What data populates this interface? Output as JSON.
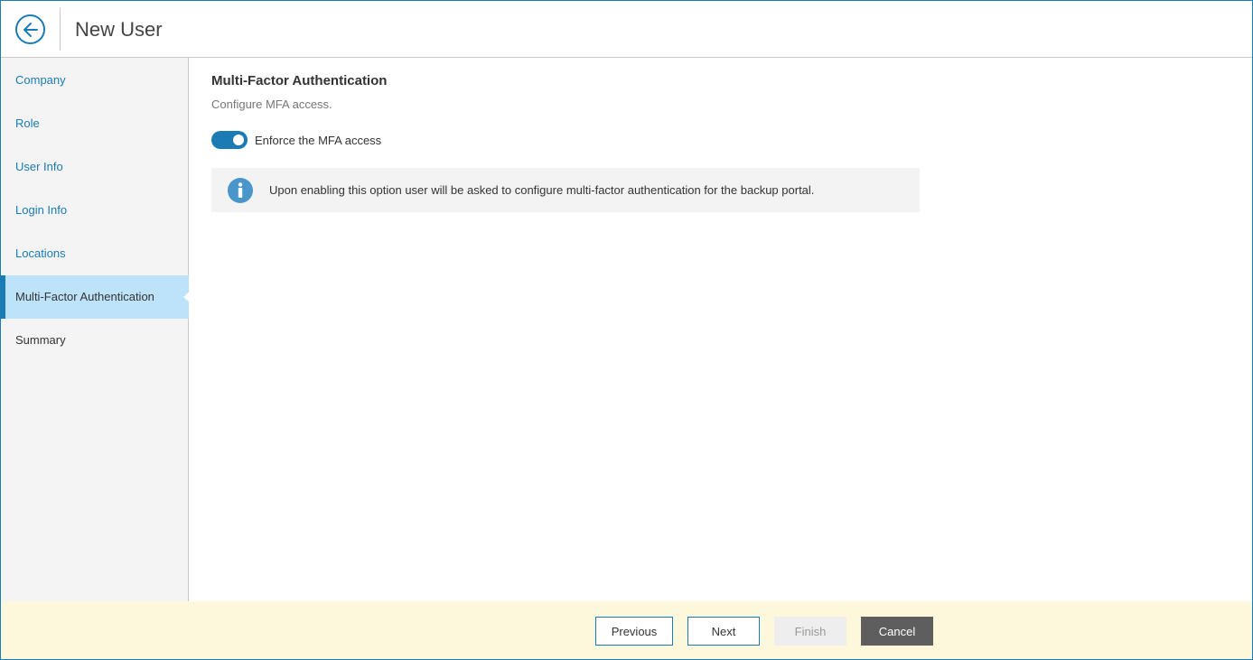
{
  "header": {
    "title": "New User",
    "back_icon": "arrow-left-circle-icon"
  },
  "sidebar": {
    "items": [
      {
        "label": "Company",
        "state": "link"
      },
      {
        "label": "Role",
        "state": "link"
      },
      {
        "label": "User Info",
        "state": "link"
      },
      {
        "label": "Login Info",
        "state": "link"
      },
      {
        "label": "Locations",
        "state": "link"
      },
      {
        "label": "Multi-Factor Authentication",
        "state": "active"
      },
      {
        "label": "Summary",
        "state": "plain"
      }
    ]
  },
  "main": {
    "title": "Multi-Factor Authentication",
    "subtitle": "Configure MFA access.",
    "toggle": {
      "label": "Enforce the MFA access",
      "checked": true
    },
    "info": {
      "icon": "info-icon",
      "text": "Upon enabling this option user will be asked to configure multi-factor authentication for the backup portal."
    }
  },
  "footer": {
    "previous_label": "Previous",
    "next_label": "Next",
    "finish_label": "Finish",
    "finish_disabled": true,
    "cancel_label": "Cancel"
  },
  "colors": {
    "accent": "#1a7bb5",
    "active_nav_bg": "#bde3fa",
    "footer_bg": "#fdf8dc",
    "info_icon": "#4a95c9",
    "cancel_bg": "#5e5e5e"
  }
}
